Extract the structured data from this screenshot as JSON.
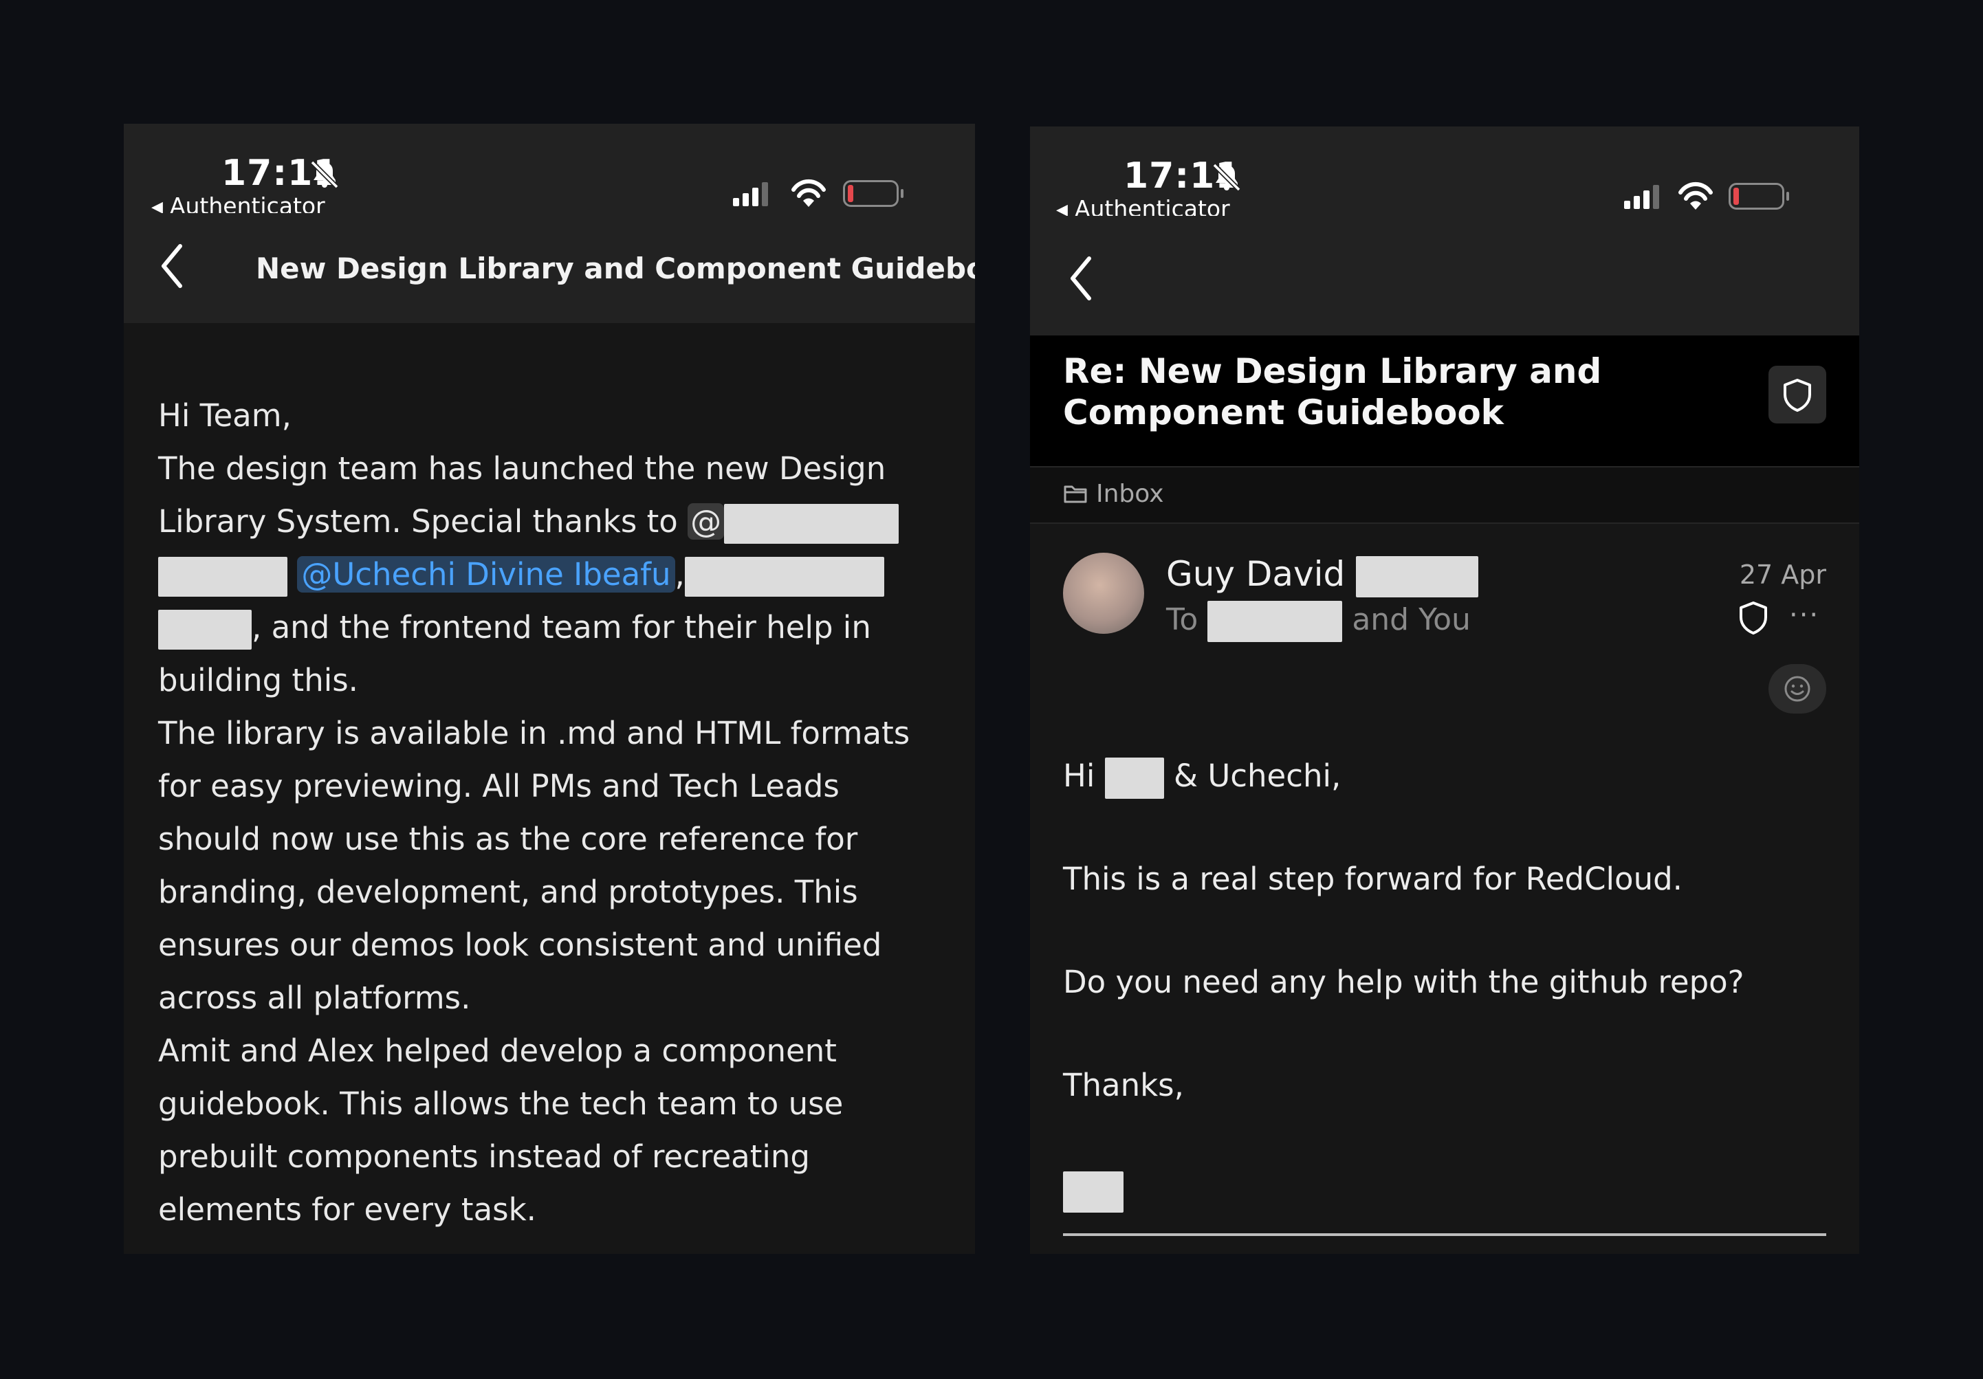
{
  "left": {
    "status": {
      "time": "17:11",
      "back_app": "Authenticator"
    },
    "nav": {
      "title": "New Design Library and Component Guidebook"
    },
    "body": {
      "greeting": "Hi Team,",
      "p1_a": "The design team has launched the new Design Library System. Special thanks to ",
      "p1_at": "@",
      "p1_mention": "@Uchechi Divine Ibeafu",
      "p1_comma": ",",
      "p1_b": ", and the frontend team for their help in building this.",
      "p2": "The library is available in .md and HTML formats for easy previewing. All PMs and Tech Leads should now use this as the core reference for branding, development, and prototypes. This ensures our demos look consistent and unified across all platforms.",
      "p3": "Amit and Alex helped develop a component guidebook. This allows the tech team to use prebuilt components instead of recreating elements for every task."
    }
  },
  "right": {
    "status": {
      "time": "17:11",
      "back_app": "Authenticator"
    },
    "subject": "Re: New Design Library and Component Guidebook",
    "folder": "Inbox",
    "sender": {
      "name": "Guy David",
      "to_prefix": "To",
      "to_suffix": "and You",
      "date": "27 Apr"
    },
    "body": {
      "hi_a": "Hi",
      "hi_b": "& Uchechi,",
      "line1": "This is a real step forward for RedCloud.",
      "line2": "Do you need any help with the github repo?",
      "line3": "Thanks,"
    }
  },
  "colors": {
    "background": "#0d0f14",
    "bar": "#222222",
    "mail_bg": "#161616",
    "link": "#4aa3ff",
    "battery_low": "#e5484d"
  }
}
